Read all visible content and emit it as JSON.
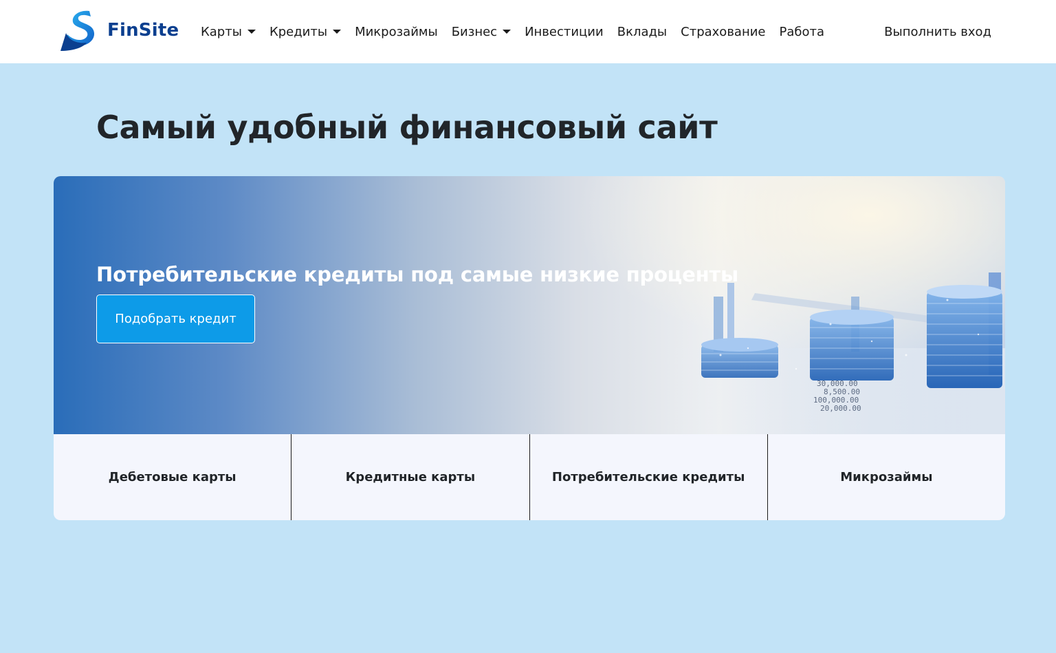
{
  "brand": {
    "name": "FinSite",
    "primary_color": "#0b3f8f",
    "accent_color": "#1e88e5"
  },
  "nav": {
    "items": [
      {
        "label": "Карты",
        "dropdown": true
      },
      {
        "label": "Кредиты",
        "dropdown": true
      },
      {
        "label": "Микрозаймы",
        "dropdown": false
      },
      {
        "label": "Бизнес",
        "dropdown": true
      },
      {
        "label": "Инвестиции",
        "dropdown": false
      },
      {
        "label": "Вклады",
        "dropdown": false
      },
      {
        "label": "Страхование",
        "dropdown": false
      },
      {
        "label": "Работа",
        "dropdown": false
      }
    ],
    "login_label": "Выполнить вход"
  },
  "hero": {
    "title": "Самый удобный финансовый сайт"
  },
  "banner": {
    "heading": "Потребительские кредиты под самые низкие проценты",
    "button_label": "Подобрать кредит",
    "button_color": "#0d9be8",
    "image_numbers": [
      "30,000.00",
      "8,500.00",
      "100,000.00",
      "20,000.00"
    ]
  },
  "categories": [
    {
      "label": "Дебетовые карты"
    },
    {
      "label": "Кредитные карты"
    },
    {
      "label": "Потребительские кредиты"
    },
    {
      "label": "Микрозаймы"
    }
  ],
  "page_background": "#c2e3f7"
}
